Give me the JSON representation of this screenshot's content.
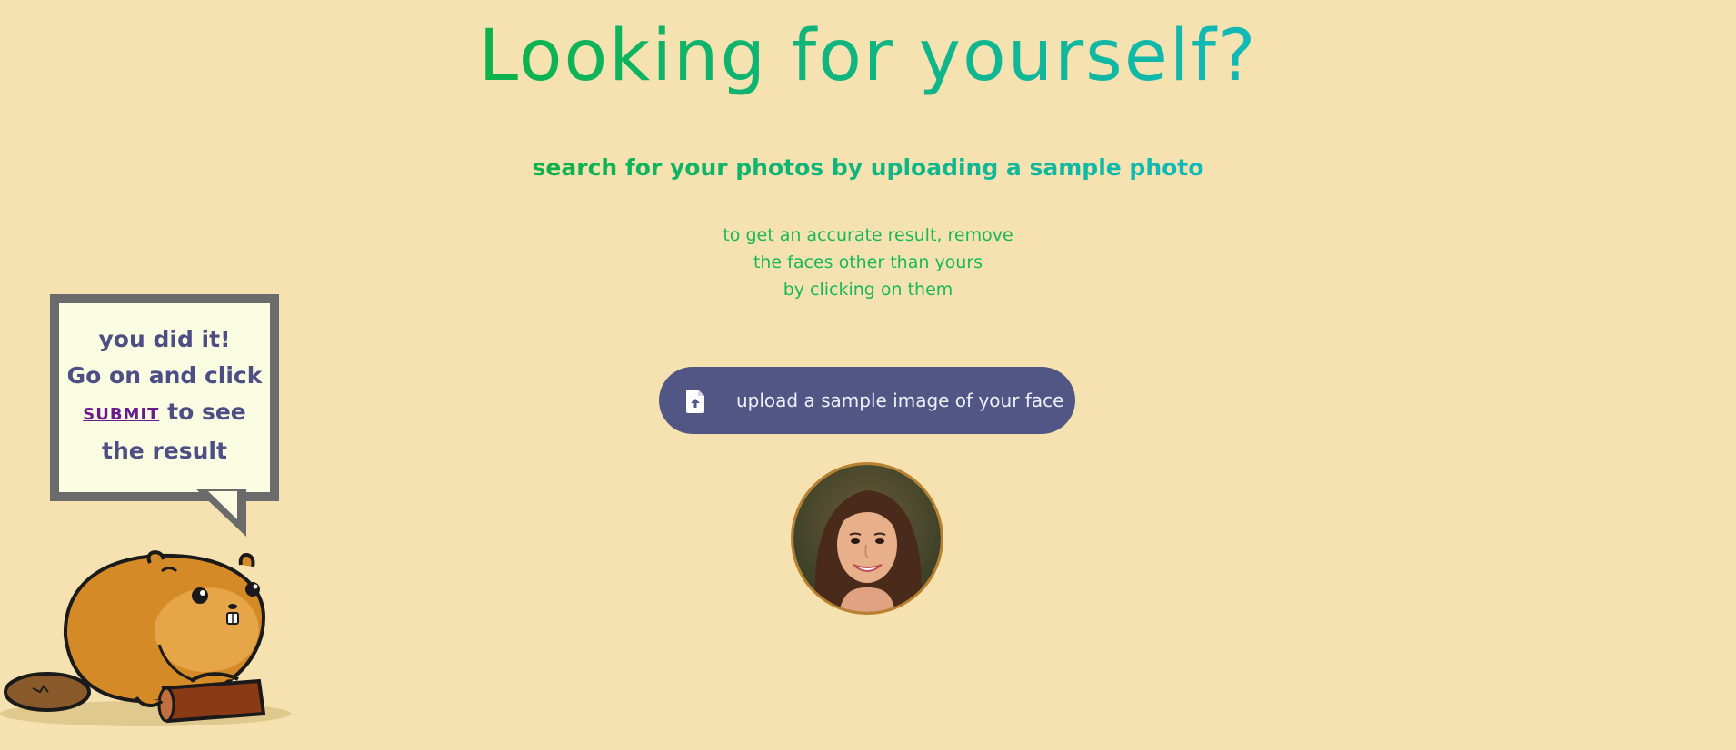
{
  "header": {
    "title": "Looking for yourself?",
    "subtitle": "search for your photos by uploading a sample photo"
  },
  "hint": {
    "lines": [
      "to get an accurate result, remove",
      "the faces other than yours",
      "by clicking on them"
    ]
  },
  "upload": {
    "label": "upload a sample image of your face",
    "icon": "file-upload-icon"
  },
  "preview": {
    "icon": "face-photo"
  },
  "bubble": {
    "line1": "you did it!",
    "line2": "Go on and click",
    "link": "SUBMIT",
    "line3_suffix": " to see",
    "line4": "the result"
  },
  "mascot": {
    "icon": "beaver-mascot"
  },
  "colors": {
    "background": "#f5e2b0",
    "gradient_start": "#0db24a",
    "gradient_end": "#11b9b9",
    "button": "#525684",
    "bubble_text": "#4c4e84",
    "bubble_border": "#6b6b6b",
    "link": "#6a1a8a"
  }
}
